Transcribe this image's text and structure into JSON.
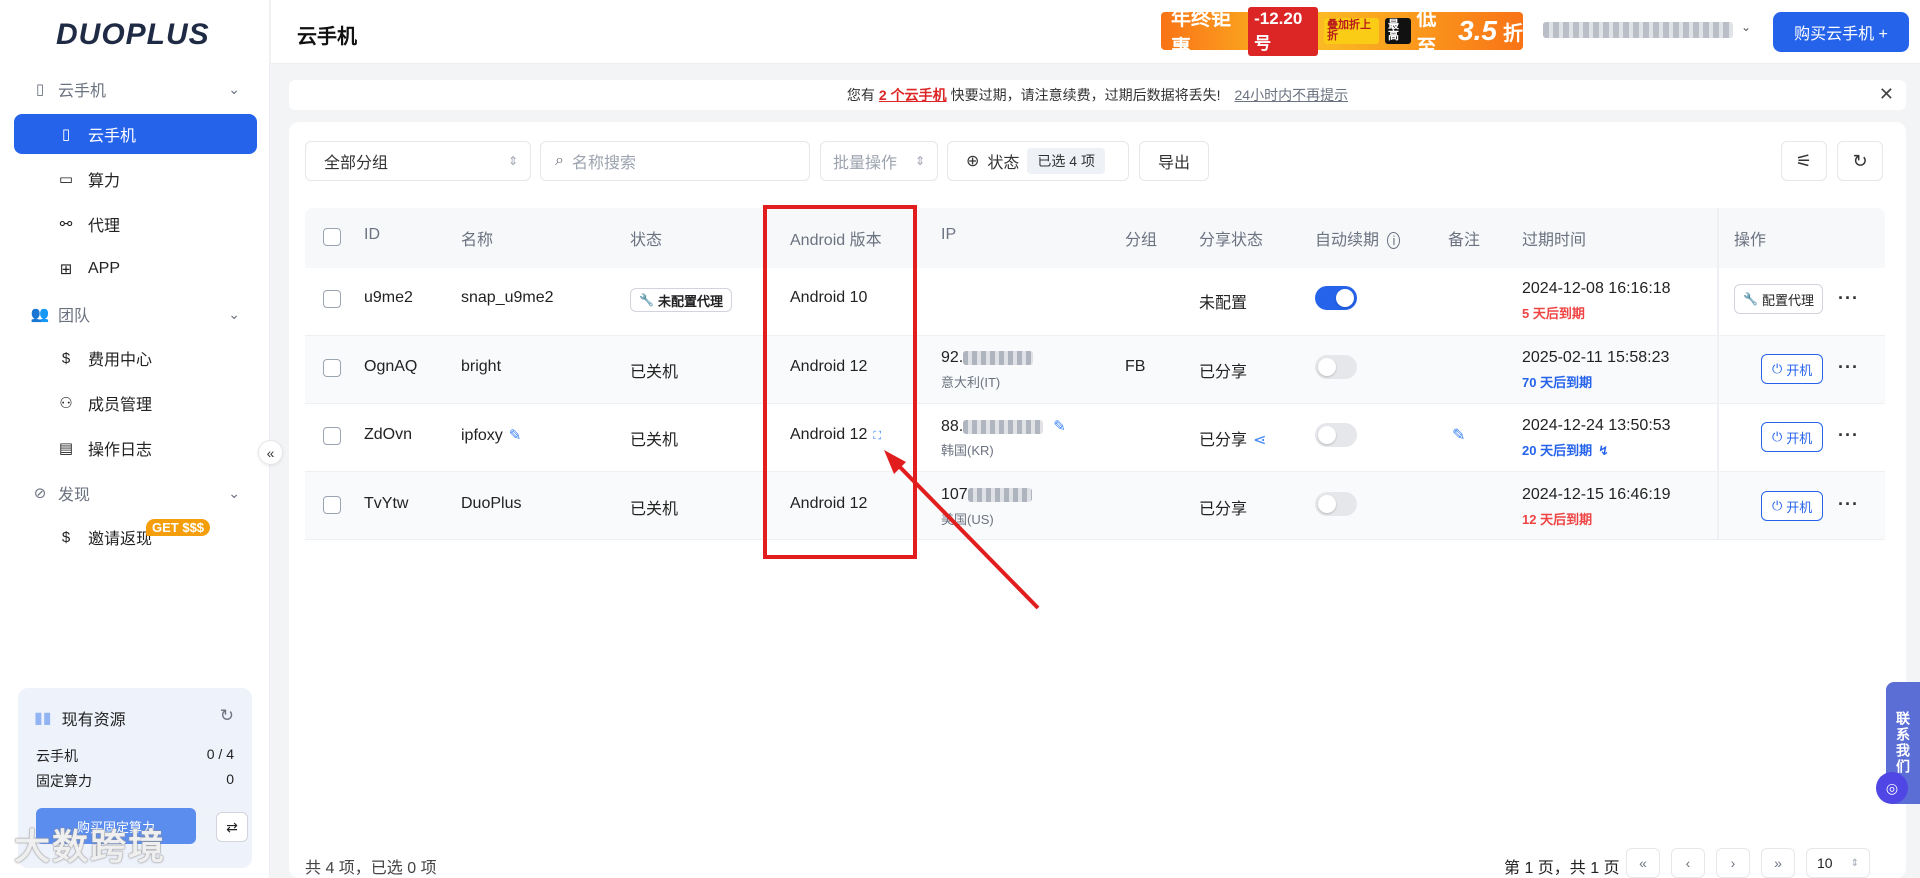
{
  "sidebar": {
    "logo": "DUOPLUS",
    "groups": [
      {
        "label": "云手机"
      },
      {
        "label": "团队"
      },
      {
        "label": "发现"
      }
    ],
    "items": {
      "cloud_phone": "云手机",
      "compute": "算力",
      "proxy": "代理",
      "app": "APP",
      "billing": "费用中心",
      "members": "成员管理",
      "oplog": "操作日志",
      "invite": "邀请返现",
      "invite_badge": "GET $$$"
    },
    "resources": {
      "title": "现有资源",
      "rows": [
        {
          "label": "云手机",
          "value": "0 / 4"
        },
        {
          "label": "固定算力",
          "value": "0"
        }
      ],
      "buy_label": "购买固定算力"
    },
    "watermark": "大数跨境"
  },
  "header": {
    "title": "云手机",
    "promo": {
      "t1": "年终钜惠",
      "t2": "-12.20号",
      "t3": "叠加折上折",
      "t4": "最高",
      "t5": "低至",
      "t6": "3.5",
      "t7": "折"
    },
    "buy_button": "购买云手机 +"
  },
  "notice": {
    "prefix": "您有",
    "highlight": "2 个云手机",
    "suffix": "快要过期，请注意续费，过期后数据将丢失!",
    "dismiss": "24小时内不再提示"
  },
  "toolbar": {
    "group_select": "全部分组",
    "search_placeholder": "名称搜索",
    "batch": "批量操作",
    "status": "状态",
    "selected": "已选 4 项",
    "export": "导出"
  },
  "table": {
    "headers": {
      "id": "ID",
      "name": "名称",
      "status": "状态",
      "android": "Android 版本",
      "ip": "IP",
      "group": "分组",
      "share": "分享状态",
      "auto_renew": "自动续期",
      "note": "备注",
      "expire": "过期时间",
      "ops": "操作"
    },
    "rows": [
      {
        "id": "u9me2",
        "name": "snap_u9me2",
        "status": "未配置代理",
        "android": "Android 10",
        "ip": "",
        "ip_region": "",
        "group": "",
        "share": "未配置",
        "auto_renew": true,
        "expire": "2024-12-08 16:16:18",
        "remain": "5 天后到期",
        "remain_kind": "warn",
        "op": "配置代理"
      },
      {
        "id": "OgnAQ",
        "name": "bright",
        "status": "已关机",
        "android": "Android 12",
        "ip": "92.",
        "ip_region": "意大利(IT)",
        "group": "FB",
        "share": "已分享",
        "auto_renew": false,
        "expire": "2025-02-11 15:58:23",
        "remain": "70 天后到期",
        "remain_kind": "ok",
        "op": "开机"
      },
      {
        "id": "ZdOvn",
        "name": "ipfoxy",
        "status": "已关机",
        "android": "Android 12",
        "ip": "88.",
        "ip_region": "韩国(KR)",
        "group": "",
        "share": "已分享",
        "auto_renew": false,
        "expire": "2024-12-24 13:50:53",
        "remain": "20 天后到期",
        "remain_kind": "ok",
        "op": "开机"
      },
      {
        "id": "TvYtw",
        "name": "DuoPlus",
        "status": "已关机",
        "android": "Android 12",
        "ip": "107",
        "ip_region": "美国(US)",
        "group": "",
        "share": "已分享",
        "auto_renew": false,
        "expire": "2024-12-15 16:46:19",
        "remain": "12 天后到期",
        "remain_kind": "warn",
        "op": "开机"
      }
    ]
  },
  "footer": {
    "summary": "共 4 项，已选 0 项",
    "page_info": "第 1 页，共 1 页",
    "page_size": "10"
  },
  "contact": "联系我们",
  "colors": {
    "primary": "#2563eb",
    "warn": "#ef4444",
    "annotation": "#e11d1d"
  }
}
